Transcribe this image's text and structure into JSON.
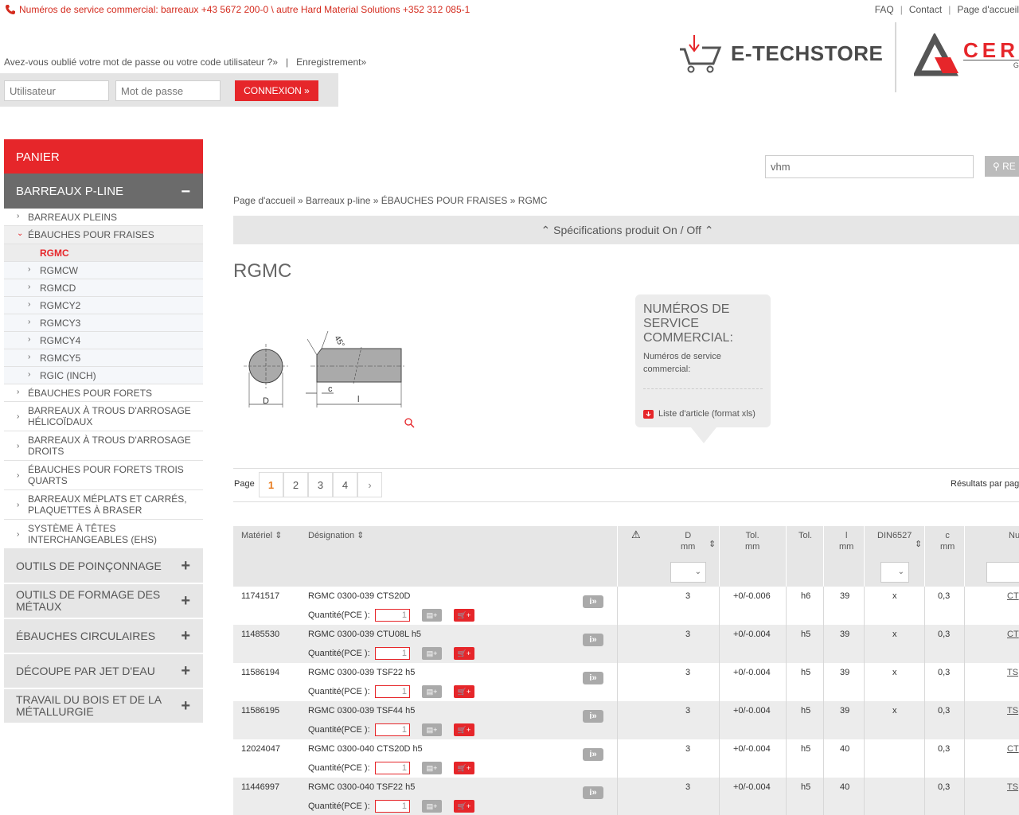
{
  "topbar": {
    "phone_text": "Numéros de service commercial: barreaux +43 5672 200-0 \\ autre Hard Material Solutions +352 312 085-1",
    "links": [
      "FAQ",
      "Contact",
      "Page d'accueil"
    ]
  },
  "login": {
    "forgot": "Avez-vous oublié votre mot de passe ou votre code utilisateur ?»",
    "register": "Enregistrement»",
    "user_placeholder": "Utilisateur",
    "password_placeholder": "Mot de passe",
    "button": "CONNEXION"
  },
  "logos": {
    "etechstore": "E-TECHSTORE",
    "cer": "CER",
    "cer_sub": "G"
  },
  "sidebar": {
    "cart": "PANIER",
    "section": "BARREAUX P-LINE",
    "section_toggle": "−",
    "items": [
      {
        "label": "BARREAUX PLEINS"
      },
      {
        "label": "ÉBAUCHES POUR FRAISES"
      }
    ],
    "subitems": [
      "RGMC",
      "RGMCW",
      "RGMCD",
      "RGMCY2",
      "RGMCY3",
      "RGMCY4",
      "RGMCY5",
      "RGIC (INCH)"
    ],
    "items_after": [
      {
        "label": "ÉBAUCHES POUR FORETS"
      },
      {
        "label": "BARREAUX À TROUS D'ARROSAGE HÉLICOÏDAUX"
      },
      {
        "label": "BARREAUX À TROUS D'ARROSAGE DROITS"
      },
      {
        "label": "ÉBAUCHES POUR FORETS TROIS QUARTS"
      },
      {
        "label": "BARREAUX MÉPLATS ET CARRÉS, PLAQUETTES À BRASER"
      },
      {
        "label": "SYSTÈME À TÊTES INTERCHANGEABLES (EHS)"
      }
    ],
    "categories": [
      "OUTILS DE POINÇONNAGE",
      "OUTILS DE FORMAGE DES MÉTAUX",
      "ÉBAUCHES CIRCULAIRES",
      "DÉCOUPE PAR JET D'EAU",
      "TRAVAIL DU BOIS ET DE LA MÉTALLURGIE"
    ],
    "category_toggle": "+"
  },
  "search": {
    "value": "vhm",
    "button": "RE"
  },
  "breadcrumb": "Page d'accueil » Barreaux p-line » ÉBAUCHES POUR FRAISES » RGMC",
  "specs_toggle": "Spécifications produit On / Off",
  "page_title": "RGMC",
  "drawing": {
    "d": "D",
    "c": "c",
    "l": "l",
    "angle": "45°"
  },
  "info_box": {
    "heading": "NUMÉROS DE SERVICE COMMERCIAL:",
    "sub": "Numéros de service commercial:",
    "list_link": "Liste d'article (format xls)"
  },
  "pager": {
    "label": "Page",
    "pages": [
      "1",
      "2",
      "3",
      "4"
    ],
    "current": "1",
    "next": ">",
    "results_label": "Résultats par pag"
  },
  "table": {
    "headers": {
      "material": "Matériel",
      "designation": "Désignation",
      "d": "D",
      "d_unit": "mm",
      "tol1": "Tol.",
      "tol1_unit": "mm",
      "tol2": "Tol.",
      "l": "l",
      "l_unit": "mm",
      "din": "DIN6527",
      "c": "c",
      "c_unit": "mm",
      "nu": "Nu"
    },
    "qty_label": "Quantité(PCE ):",
    "qty_value": "1",
    "rows": [
      {
        "material": "11741517",
        "designation": "RGMC 0300-039 CTS20D",
        "d": "3",
        "tol1": "+0/-0.006",
        "tol2": "h6",
        "l": "39",
        "din": "x",
        "c": "0,3",
        "nu": "CT"
      },
      {
        "material": "11485530",
        "designation": "RGMC 0300-039 CTU08L h5",
        "d": "3",
        "tol1": "+0/-0.004",
        "tol2": "h5",
        "l": "39",
        "din": "x",
        "c": "0,3",
        "nu": "CT"
      },
      {
        "material": "11586194",
        "designation": "RGMC 0300-039 TSF22 h5",
        "d": "3",
        "tol1": "+0/-0.004",
        "tol2": "h5",
        "l": "39",
        "din": "x",
        "c": "0,3",
        "nu": "TS"
      },
      {
        "material": "11586195",
        "designation": "RGMC 0300-039 TSF44 h5",
        "d": "3",
        "tol1": "+0/-0.004",
        "tol2": "h5",
        "l": "39",
        "din": "x",
        "c": "0,3",
        "nu": "TS"
      },
      {
        "material": "12024047",
        "designation": "RGMC 0300-040 CTS20D h5",
        "d": "3",
        "tol1": "+0/-0.004",
        "tol2": "h5",
        "l": "40",
        "din": "",
        "c": "0,3",
        "nu": "CT"
      },
      {
        "material": "11446997",
        "designation": "RGMC 0300-040 TSF22 h5",
        "d": "3",
        "tol1": "+0/-0.004",
        "tol2": "h5",
        "l": "40",
        "din": "",
        "c": "0,3",
        "nu": "TS"
      }
    ]
  },
  "colors": {
    "accent": "#e6262a",
    "sidebar_section": "#6b6b6b",
    "panel": "#e6e6e6"
  }
}
